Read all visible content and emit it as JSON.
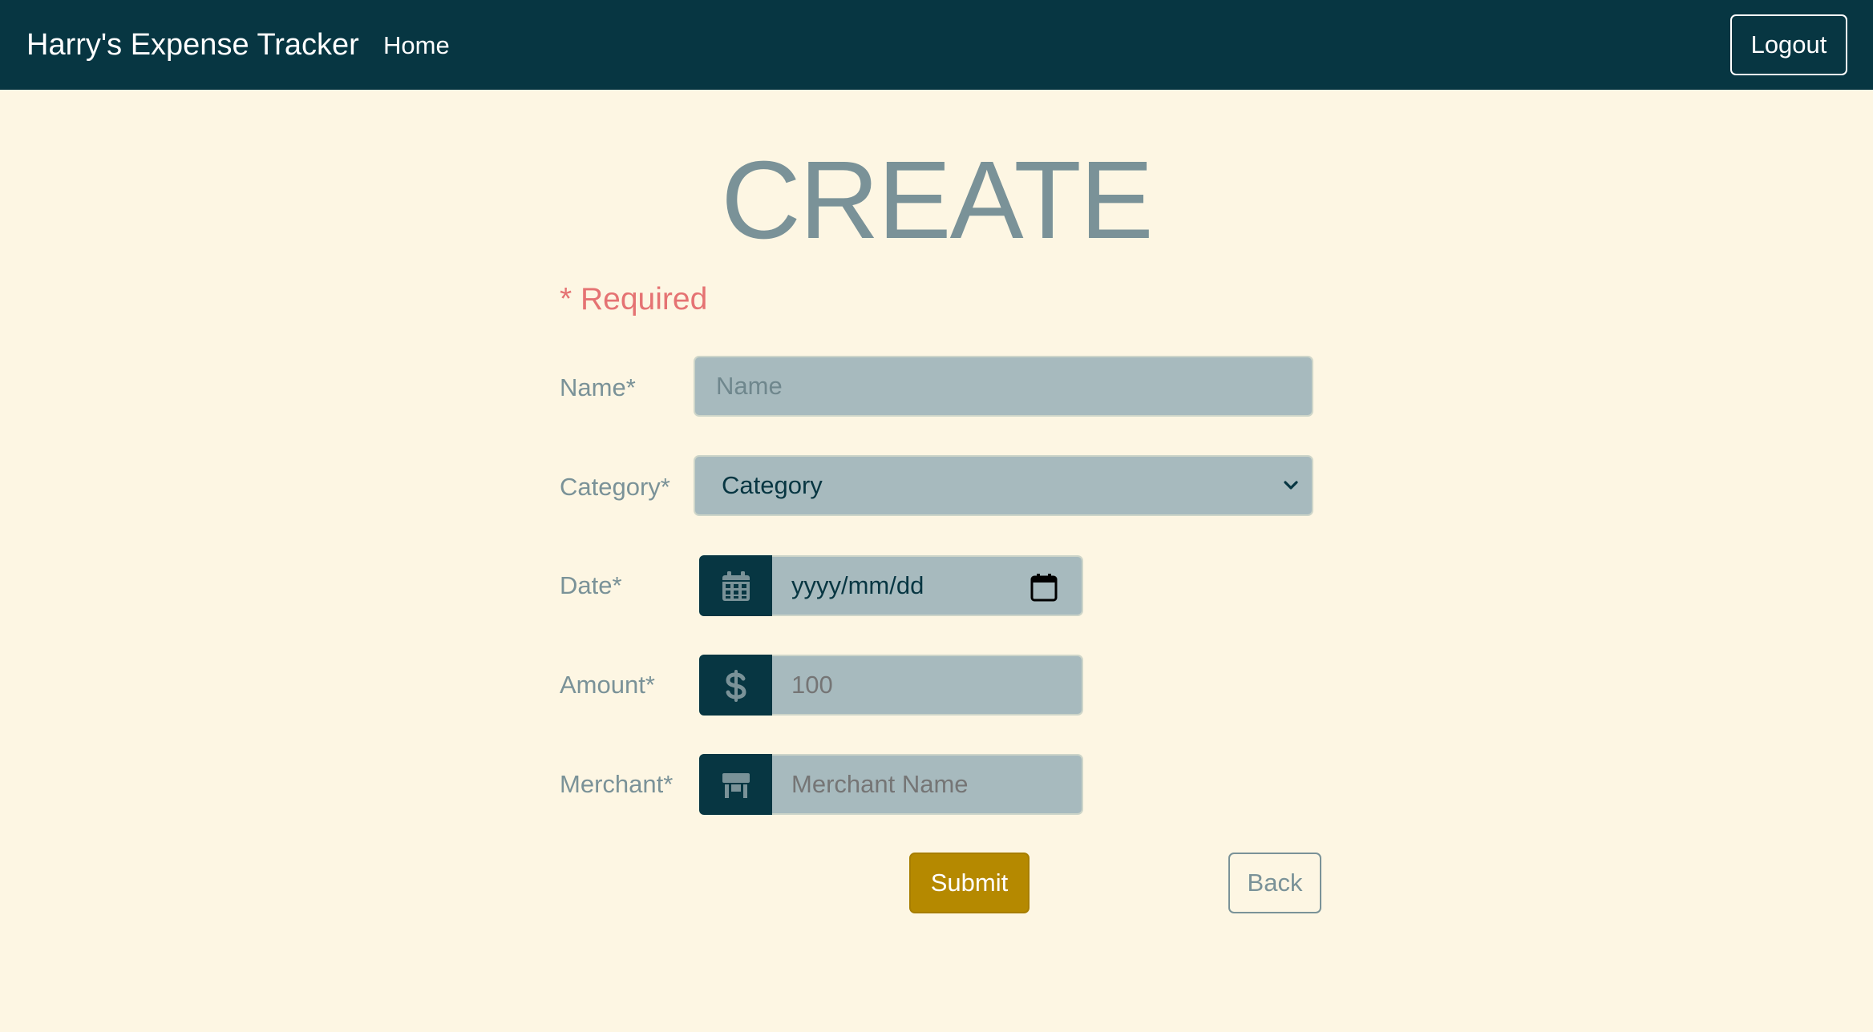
{
  "navbar": {
    "brand": "Harry's Expense Tracker",
    "home_link": "Home",
    "logout_label": "Logout"
  },
  "page": {
    "title": "CREATE",
    "required_note": "* Required"
  },
  "form": {
    "name": {
      "label": "Name*",
      "placeholder": "Name"
    },
    "category": {
      "label": "Category*",
      "selected": "Category",
      "icon": "chevron-down-icon"
    },
    "date": {
      "label": "Date*",
      "placeholder": "yyyy/mm/dd",
      "addon_icon": "calendar-icon",
      "picker_icon": "calendar-picker-icon"
    },
    "amount": {
      "label": "Amount*",
      "placeholder": "100",
      "addon_icon": "dollar-icon"
    },
    "merchant": {
      "label": "Merchant*",
      "placeholder": "Merchant Name",
      "addon_icon": "store-icon"
    },
    "submit_label": "Submit",
    "back_label": "Back"
  },
  "colors": {
    "navbar": "#073642",
    "background": "#fdf6e3",
    "input": "#a7babe",
    "muted_text": "#7a9298",
    "required": "#e57373",
    "submit": "#b58900"
  }
}
